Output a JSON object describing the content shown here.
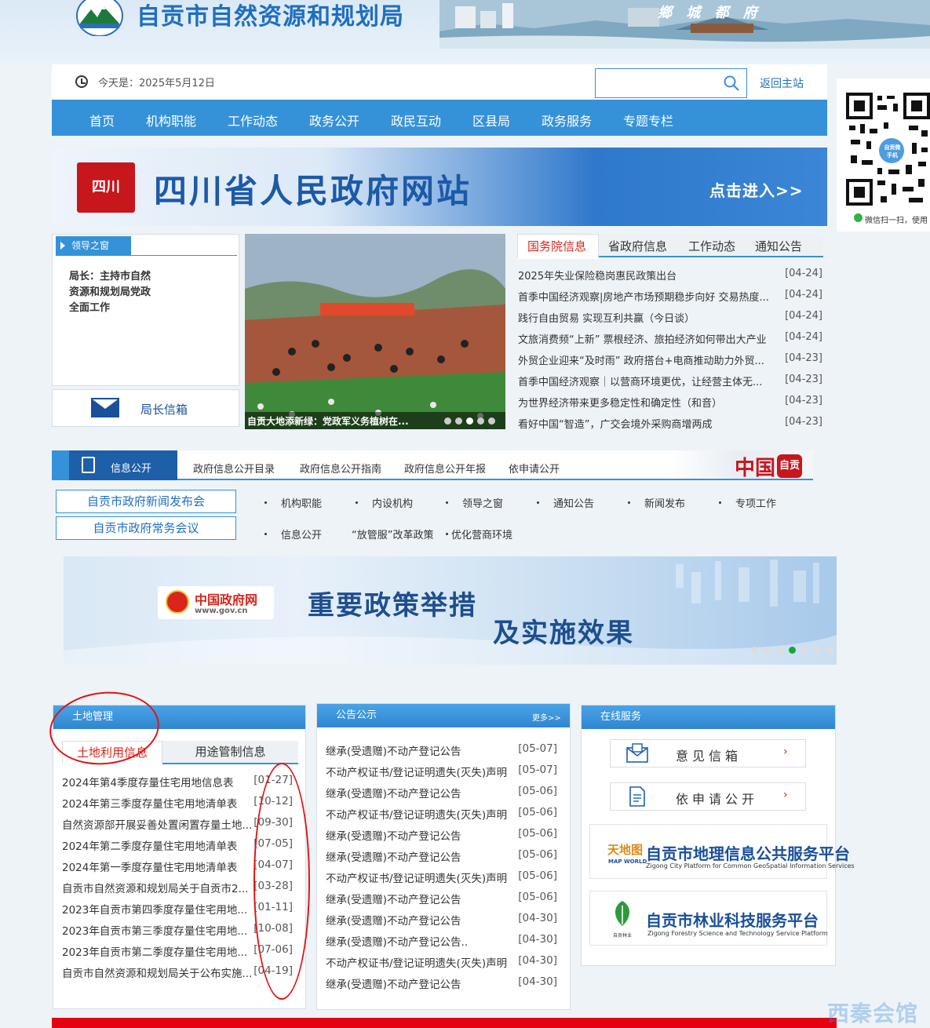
{
  "header": {
    "site_title": "自贡市自然资源和规划局",
    "slogan": "鄉 城 都 府"
  },
  "topbar": {
    "today": "今天是：2025年5月12日",
    "search_placeholder": "",
    "back_home": "返回主站"
  },
  "nav": [
    "首页",
    "机构职能",
    "工作动态",
    "政务公开",
    "政民互动",
    "区县局",
    "政务服务",
    "专题专栏"
  ],
  "sc_banner": {
    "seal": "四川",
    "title": "四川省人民政府网站",
    "enter": "点击进入>>"
  },
  "leader": {
    "tab": "领导之窗",
    "text": "局长：主持市自然资源和规划局党政全面工作",
    "mailbox": "局长信箱"
  },
  "photo": {
    "caption": "自贡大地添新绿：党政军义务植树在...",
    "slide_count": 5,
    "active_slide": 3
  },
  "news": {
    "tabs": [
      "国务院信息",
      "省政府信息",
      "工作动态",
      "通知公告"
    ],
    "items": [
      {
        "title": "2025年失业保险稳岗惠民政策出台",
        "date": "[04-24]"
      },
      {
        "title": "首季中国经济观察|房地产市场预期稳步向好 交易热度...",
        "date": "[04-24]"
      },
      {
        "title": "践行自由贸易 实现互利共赢（今日谈）",
        "date": "[04-24]"
      },
      {
        "title": "文旅消费频“上新” 票根经济、旅拍经济如何带出大产业",
        "date": "[04-24]"
      },
      {
        "title": "外贸企业迎来“及时雨” 政府搭台+电商推动助力外贸...",
        "date": "[04-23]"
      },
      {
        "title": "首季中国经济观察｜以营商环境更优，让经营主体无...",
        "date": "[04-23]"
      },
      {
        "title": "为世界经济带来更多稳定性和确定性（和音）",
        "date": "[04-23]"
      },
      {
        "title": "看好中国“智造”，广交会境外采购商增两成",
        "date": "[04-23]"
      }
    ]
  },
  "info_open": {
    "tab": "信息公开",
    "links": [
      "政府信息公开目录",
      "政府信息公开指南",
      "政府信息公开年报",
      "依申请公开"
    ],
    "china_logo": "中国",
    "china_seal": "自贡",
    "press_buttons": [
      "自贡市政府新闻发布会",
      "自贡市政府常务会议"
    ],
    "categories_row1": [
      "机构职能",
      "内设机构",
      "领导之窗",
      "通知公告",
      "新闻发布",
      "专项工作"
    ],
    "categories_row2": [
      "信息公开",
      "“放管服”改革政策",
      "优化营商环境"
    ]
  },
  "policy_banner": {
    "gov_name": "中国政府网",
    "gov_url": "www.gov.cn",
    "title_line1": "重要政策举措",
    "title_line2": "及实施效果",
    "slide_count": 7,
    "active_slide": 4
  },
  "land": {
    "head": "土地管理",
    "tabs": [
      "土地利用信息",
      "用途管制信息"
    ],
    "items": [
      {
        "title": "2024年第4季度存量住宅用地信息表",
        "date": "[01-27]"
      },
      {
        "title": "2024年第三季度存量住宅用地清单表",
        "date": "[10-12]"
      },
      {
        "title": "自然资源部开展妥善处置闲置存量土地...",
        "date": "[09-30]"
      },
      {
        "title": "2024年第二季度存量住宅用地清单表",
        "date": "[07-05]"
      },
      {
        "title": "2024年第一季度存量住宅用地清单表",
        "date": "[04-07]"
      },
      {
        "title": "自贡市自然资源和规划局关于自贡市2...",
        "date": "[03-28]"
      },
      {
        "title": "2023年自贡市第四季度存量住宅用地...",
        "date": "[01-11]"
      },
      {
        "title": "2023年自贡市第三季度存量住宅用地...",
        "date": "[10-08]"
      },
      {
        "title": "2023年自贡市第二季度存量住宅用地...",
        "date": "[07-06]"
      },
      {
        "title": "自贡市自然资源和规划局关于公布实施...",
        "date": "[04-19]"
      }
    ]
  },
  "notice": {
    "head": "公告公示",
    "more": "更多>>",
    "items": [
      {
        "title": "继承(受遗赠)不动产登记公告",
        "date": "[05-07]"
      },
      {
        "title": "不动产权证书/登记证明遗失(灭失)声明",
        "date": "[05-07]"
      },
      {
        "title": "继承(受遗赠)不动产登记公告",
        "date": "[05-06]"
      },
      {
        "title": "不动产权证书/登记证明遗失(灭失)声明",
        "date": "[05-06]"
      },
      {
        "title": "继承(受遗赠)不动产登记公告",
        "date": "[05-06]"
      },
      {
        "title": "继承(受遗赠)不动产登记公告",
        "date": "[05-06]"
      },
      {
        "title": "不动产权证书/登记证明遗失(灭失)声明",
        "date": "[05-06]"
      },
      {
        "title": "继承(受遗赠)不动产登记公告",
        "date": "[05-06]"
      },
      {
        "title": "继承(受遗赠)不动产登记公告",
        "date": "[04-30]"
      },
      {
        "title": "继承(受遗赠)不动产登记公告..",
        "date": "[04-30]"
      },
      {
        "title": "不动产权证书/登记证明遗失(灭失)声明",
        "date": "[04-30]"
      },
      {
        "title": "继承(受遗赠)不动产登记公告",
        "date": "[04-30]"
      }
    ]
  },
  "services": {
    "head": "在线服务",
    "buttons": [
      "意见信箱",
      "依申请公开"
    ],
    "platforms": [
      {
        "logo": "天地图",
        "logo_sub": "MAP WORLD",
        "title": "自贡市地理信息公共服务平台",
        "subtitle": "Zigong City Platform for Common GeoSpatial Information Services"
      },
      {
        "logo_sub": "自贡林业",
        "title": "自贡市林业科技服务平台",
        "subtitle": "Zigong Forestry Science and Technology Service Platform"
      }
    ]
  },
  "qr": {
    "badge": "自贡微手机",
    "caption": "微信扫一扫，使用"
  },
  "watermark": "西秦会馆"
}
